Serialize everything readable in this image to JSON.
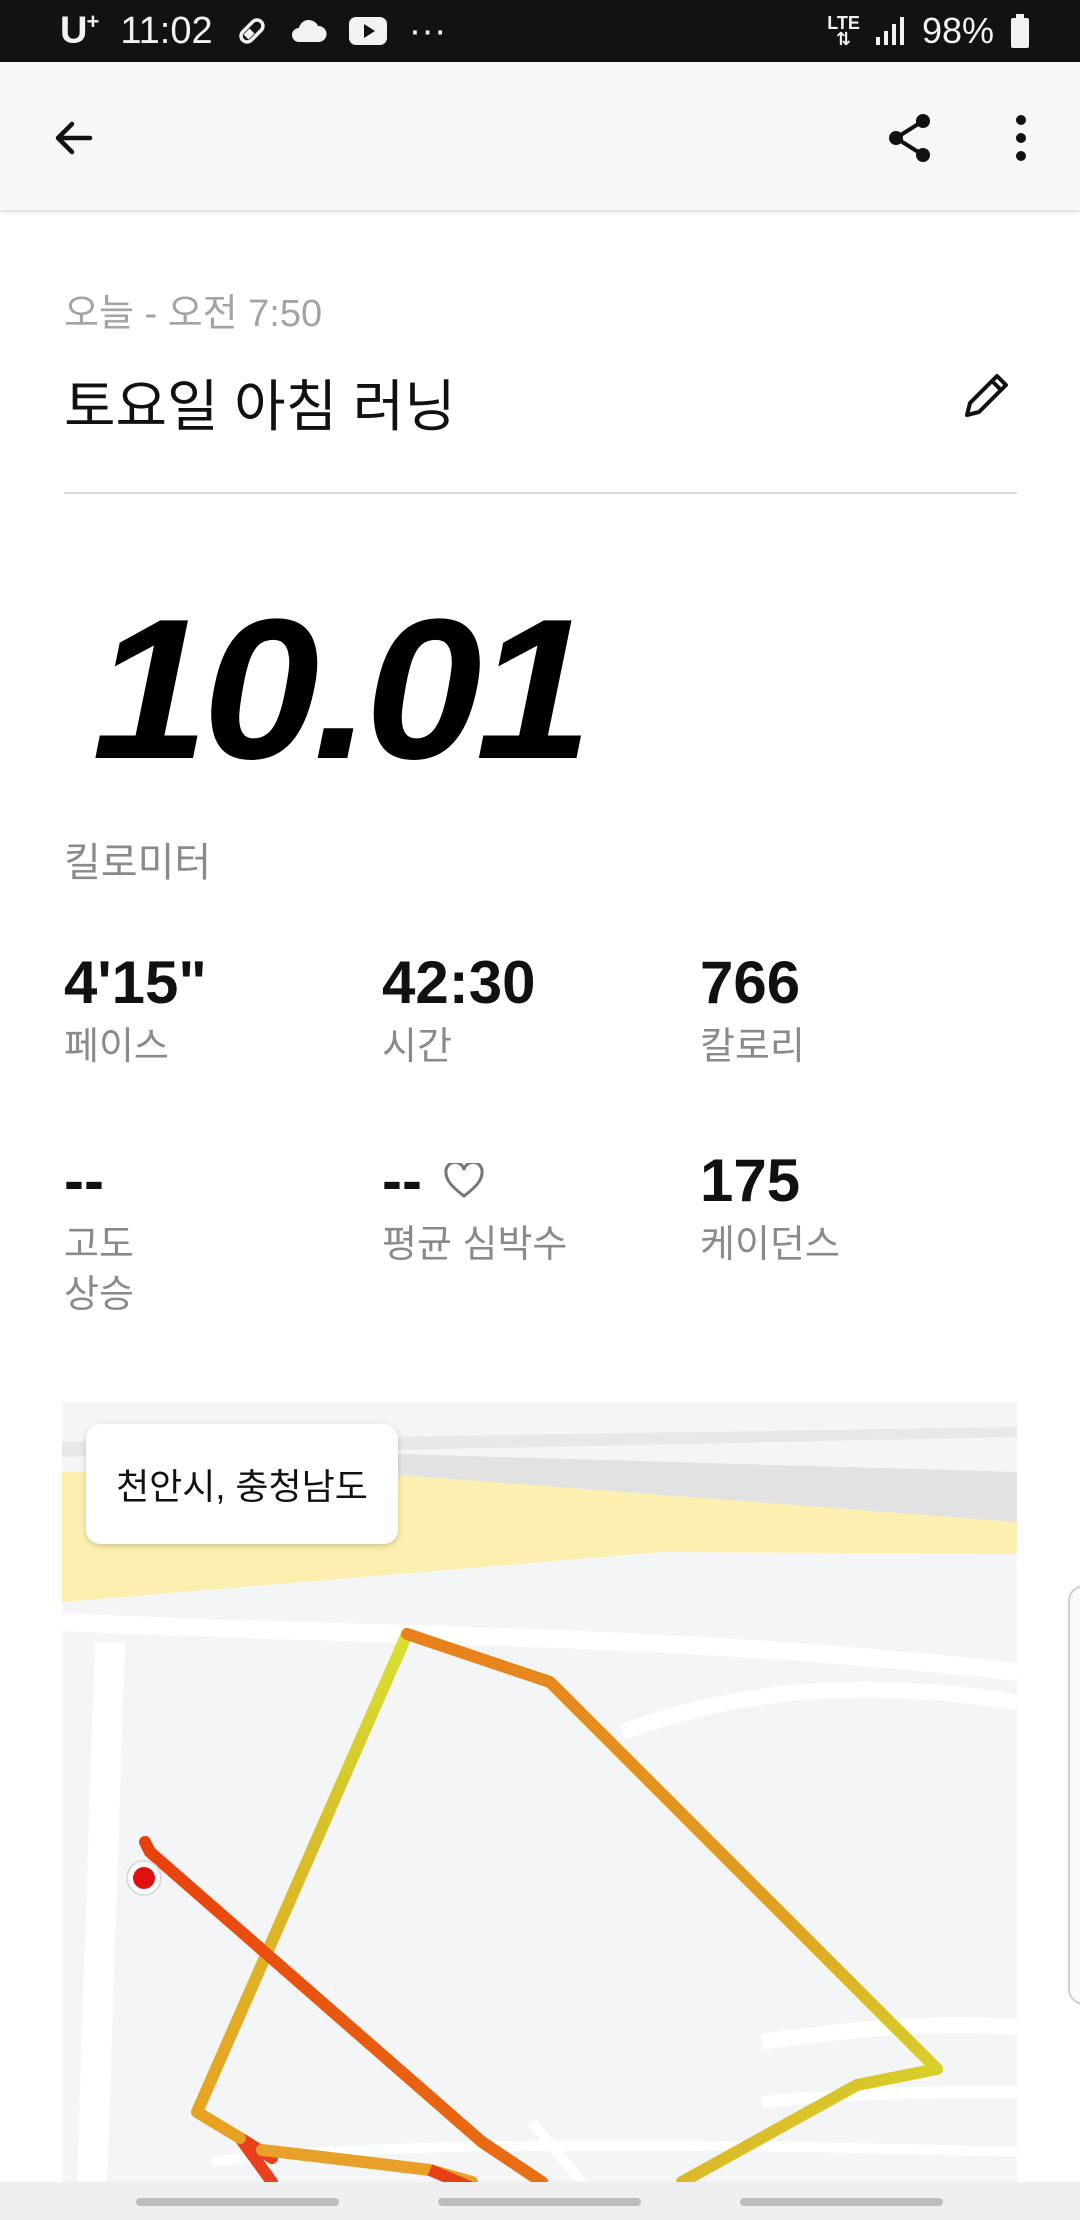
{
  "status_bar": {
    "carrier": "U",
    "carrier_sup": "+",
    "time": "11:02",
    "more": "···",
    "network": "LTE",
    "battery": "98%"
  },
  "app_bar": {
    "back_icon": "arrow-left-icon",
    "share_icon": "share-icon",
    "more_icon": "more-vertical-icon"
  },
  "activity": {
    "date": "오늘 - 오전 7:50",
    "title": "토요일 아침 러닝",
    "distance": "10.01",
    "distance_unit": "킬로미터"
  },
  "stats": [
    {
      "value": "4'15\"",
      "label": "페이스"
    },
    {
      "value": "42:30",
      "label": "시간"
    },
    {
      "value": "766",
      "label": "칼로리"
    },
    {
      "value": "--",
      "label_lines": [
        "고도",
        "상승"
      ]
    },
    {
      "value": "--",
      "label": "평균 심박수"
    },
    {
      "value": "175",
      "label": "케이던스"
    }
  ],
  "map": {
    "location": "천안시, 충청남도"
  },
  "colors": {
    "route_yellow": "#d8e030",
    "route_orange": "#e8901e",
    "route_red": "#e8400c",
    "start_marker": "#e01010"
  }
}
